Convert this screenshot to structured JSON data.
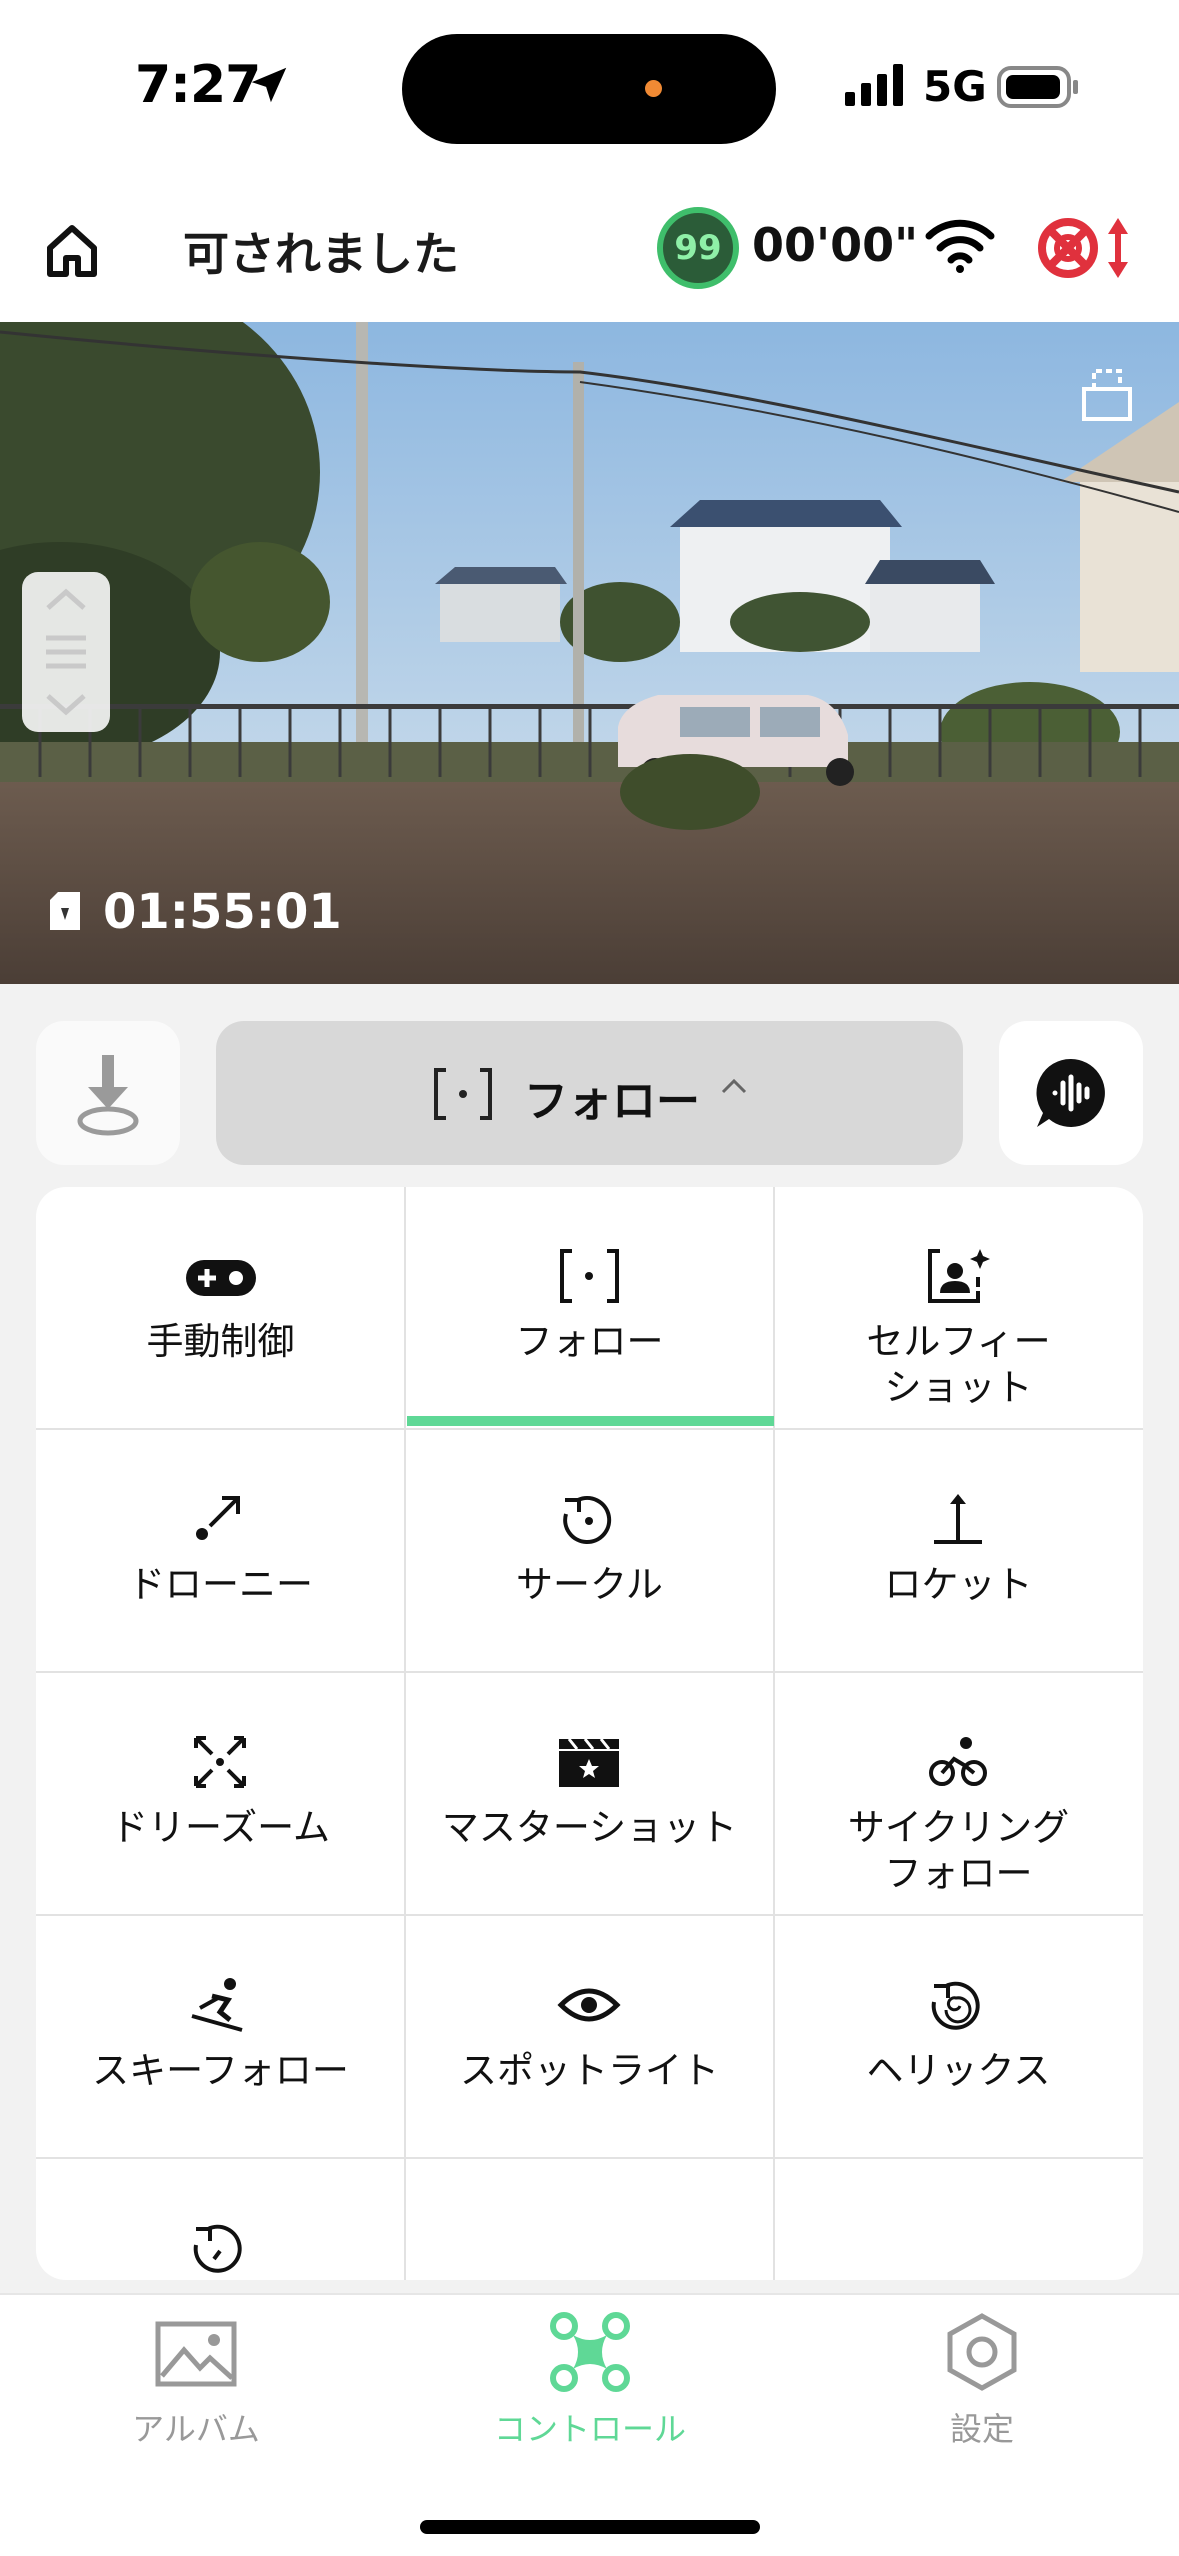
{
  "status_bar": {
    "time": "7:27",
    "network": "5G"
  },
  "header": {
    "title": "可されました",
    "battery_level": "99",
    "flight_time": "00'00\""
  },
  "camera": {
    "record_time": "01:55:01"
  },
  "control_bar": {
    "mode_label": "フォロー"
  },
  "modes": [
    {
      "label": "手動制御",
      "icon": "gamepad-icon"
    },
    {
      "label": "フォロー",
      "icon": "follow-frame-icon",
      "selected": true
    },
    {
      "label": "セルフィー\nショット",
      "icon": "selfie-icon"
    },
    {
      "label": "ドローニー",
      "icon": "dronie-icon"
    },
    {
      "label": "サークル",
      "icon": "circle-icon"
    },
    {
      "label": "ロケット",
      "icon": "rocket-icon"
    },
    {
      "label": "ドリーズーム",
      "icon": "dolly-zoom-icon"
    },
    {
      "label": "マスターショット",
      "icon": "clapperboard-icon"
    },
    {
      "label": "サイクリング\nフォロー",
      "icon": "cycling-icon"
    },
    {
      "label": "スキーフォロー",
      "icon": "ski-icon"
    },
    {
      "label": "スポットライト",
      "icon": "eye-icon"
    },
    {
      "label": "ヘリックス",
      "icon": "helix-icon"
    }
  ],
  "tabs": [
    {
      "label": "アルバム",
      "icon": "album-icon"
    },
    {
      "label": "コントロール",
      "icon": "drone-icon",
      "active": true
    },
    {
      "label": "設定",
      "icon": "settings-icon"
    }
  ],
  "colors": {
    "accent": "#5fd896",
    "battery_ring": "#3fbe6b",
    "alert": "#e0313d"
  }
}
